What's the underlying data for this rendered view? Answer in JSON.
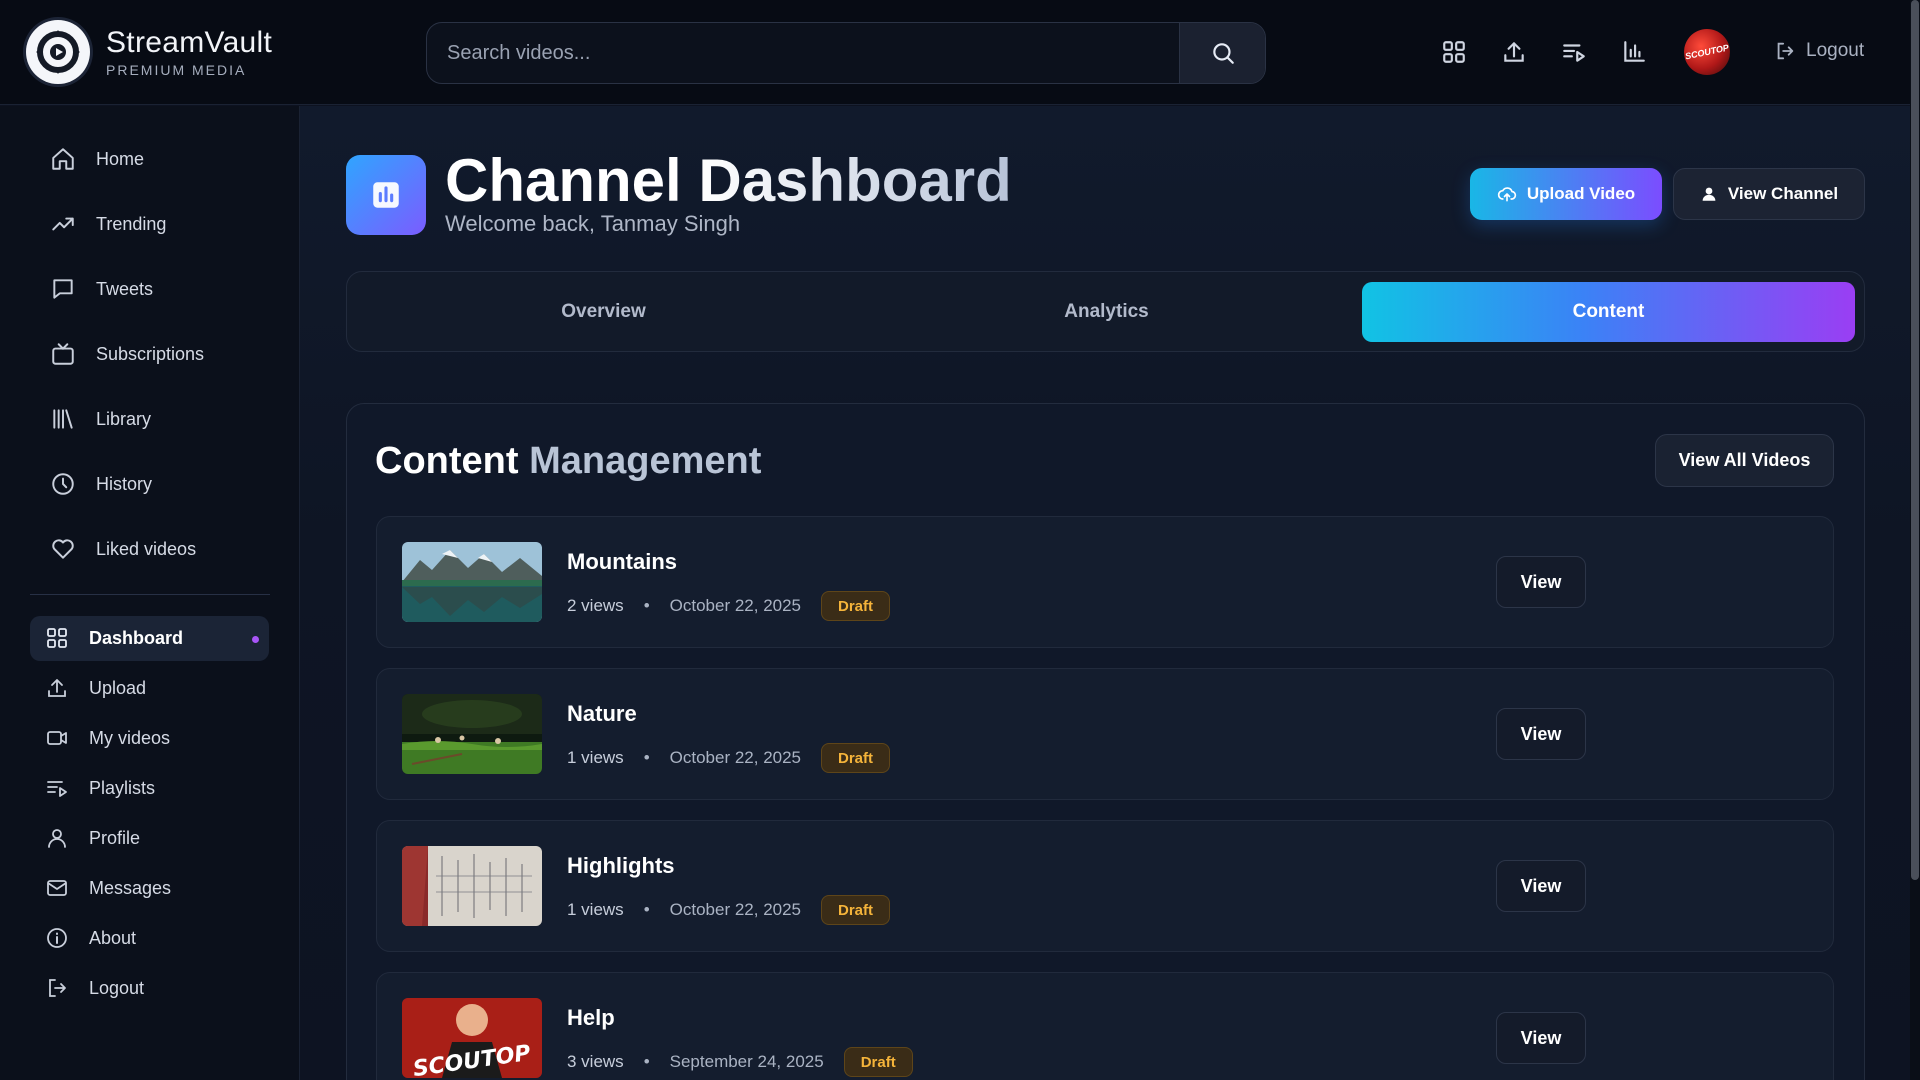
{
  "brand": {
    "name": "StreamVault",
    "tagline": "PREMIUM MEDIA"
  },
  "search": {
    "placeholder": "Search videos..."
  },
  "header": {
    "icons": [
      "dashboard-icon",
      "upload-icon",
      "playlist-icon",
      "analytics-icon"
    ],
    "logout_label": "Logout",
    "avatar_text": "SCOUTOP"
  },
  "sidebar": {
    "primary": [
      {
        "label": "Home",
        "icon": "home-icon"
      },
      {
        "label": "Trending",
        "icon": "trending-icon"
      },
      {
        "label": "Tweets",
        "icon": "tweet-icon"
      },
      {
        "label": "Subscriptions",
        "icon": "subscriptions-icon"
      },
      {
        "label": "Library",
        "icon": "library-icon"
      },
      {
        "label": "History",
        "icon": "history-icon"
      },
      {
        "label": "Liked videos",
        "icon": "heart-icon"
      }
    ],
    "secondary": [
      {
        "label": "Dashboard",
        "icon": "dashboard-icon",
        "active": true
      },
      {
        "label": "Upload",
        "icon": "upload-icon"
      },
      {
        "label": "My videos",
        "icon": "video-camera-icon"
      },
      {
        "label": "Playlists",
        "icon": "playlist-icon"
      },
      {
        "label": "Profile",
        "icon": "user-icon"
      },
      {
        "label": "Messages",
        "icon": "mail-icon"
      },
      {
        "label": "About",
        "icon": "info-icon"
      },
      {
        "label": "Logout",
        "icon": "logout-icon"
      }
    ]
  },
  "page": {
    "title": "Channel Dashboard",
    "subtitle": "Welcome back, Tanmay Singh",
    "upload_button": "Upload Video",
    "view_channel_button": "View Channel"
  },
  "tabs": [
    {
      "label": "Overview",
      "active": false
    },
    {
      "label": "Analytics",
      "active": false
    },
    {
      "label": "Content",
      "active": true
    }
  ],
  "content": {
    "title_part1": "Content",
    "title_part2": "Management",
    "view_all_button": "View All Videos",
    "videos": [
      {
        "title": "Mountains",
        "views": "2 views",
        "date": "October 22, 2025",
        "status": "Draft",
        "action": "View"
      },
      {
        "title": "Nature",
        "views": "1 views",
        "date": "October 22, 2025",
        "status": "Draft",
        "action": "View"
      },
      {
        "title": "Highlights",
        "views": "1 views",
        "date": "October 22, 2025",
        "status": "Draft",
        "action": "View"
      },
      {
        "title": "Help",
        "views": "3 views",
        "date": "September 24, 2025",
        "status": "Draft",
        "action": "View"
      }
    ]
  },
  "colors": {
    "accent_start": "#11c3e4",
    "accent_end": "#9a3ef3",
    "draft": "#f5b43a",
    "active_dot": "#a855f7"
  }
}
